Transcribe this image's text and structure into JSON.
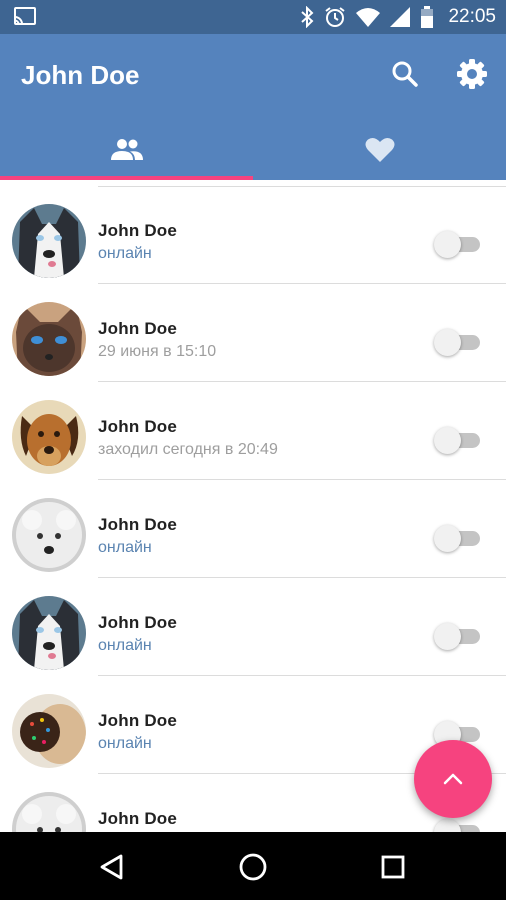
{
  "status_bar": {
    "time": "22:05",
    "icons": [
      "cast-icon",
      "bluetooth-icon",
      "alarm-icon",
      "wifi-icon",
      "signal-icon",
      "battery-icon"
    ]
  },
  "app_bar": {
    "title": "John Doe",
    "actions": [
      "search-icon",
      "settings-gear-icon"
    ],
    "background": "#5583bd"
  },
  "tabs": [
    {
      "icon": "people-icon",
      "selected": true
    },
    {
      "icon": "heart-icon",
      "selected": false
    }
  ],
  "contacts": [
    {
      "name": "John Doe",
      "status": "онлайн",
      "online": true,
      "avatar": "husky-dog-photo",
      "toggle_on": false
    },
    {
      "name": "John Doe",
      "status": "29 июня в 15:10",
      "online": false,
      "avatar": "siamese-cat-photo",
      "toggle_on": false
    },
    {
      "name": "John Doe",
      "status": "заходил сегодня в 20:49",
      "online": false,
      "avatar": "brown-dog-photo",
      "toggle_on": false
    },
    {
      "name": "John Doe",
      "status": "онлайн",
      "online": true,
      "avatar": "white-fluffy-dog-photo",
      "toggle_on": false
    },
    {
      "name": "John Doe",
      "status": "онлайн",
      "online": true,
      "avatar": "husky-dog-photo",
      "toggle_on": false
    },
    {
      "name": "John Doe",
      "status": "онлайн",
      "online": true,
      "avatar": "dog-with-sprinkles-photo",
      "toggle_on": false
    },
    {
      "name": "John Doe",
      "status": "",
      "online": false,
      "avatar": "white-fluffy-dog-photo",
      "toggle_on": false
    }
  ],
  "fab": {
    "icon": "chevron-up-icon",
    "color": "#f6437f"
  },
  "nav_bar": {
    "buttons": [
      "back-icon",
      "home-icon",
      "recents-icon"
    ]
  }
}
